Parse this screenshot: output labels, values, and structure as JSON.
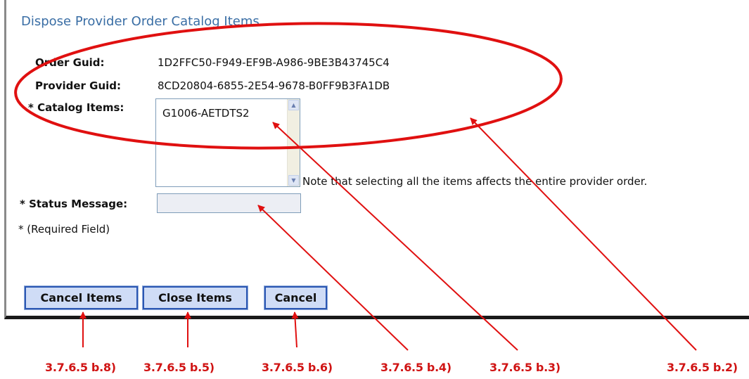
{
  "title": "Dispose Provider Order Catalog Items",
  "order_guid": {
    "label": "Order Guid:",
    "value": "1D2FFC50-F949-EF9B-A986-9BE3B43745C4"
  },
  "provider_guid": {
    "label": "Provider Guid:",
    "value": "8CD20804-6855-2E54-9678-B0FF9B3FA1DB"
  },
  "catalog_items": {
    "label": "* Catalog Items:",
    "items": [
      "G1006-AETDTS2"
    ]
  },
  "note": "Note that selecting all the items affects the entire provider order.",
  "status_message": {
    "label": "* Status Message:",
    "value": ""
  },
  "required_note": "* (Required Field)",
  "buttons": {
    "cancel_items": "Cancel Items",
    "close_items": "Close Items",
    "cancel": "Cancel"
  },
  "annotations": {
    "color": "#e01010",
    "refs": [
      "3.7.6.5 b.8)",
      "3.7.6.5 b.5)",
      "3.7.6.5 b.6)",
      "3.7.6.5 b.4)",
      "3.7.6.5 b.3)",
      "3.7.6.5 b.2)"
    ]
  },
  "icons": {
    "scroll_up": "scroll-up-arrow-icon",
    "scroll_down": "scroll-down-arrow-icon"
  }
}
